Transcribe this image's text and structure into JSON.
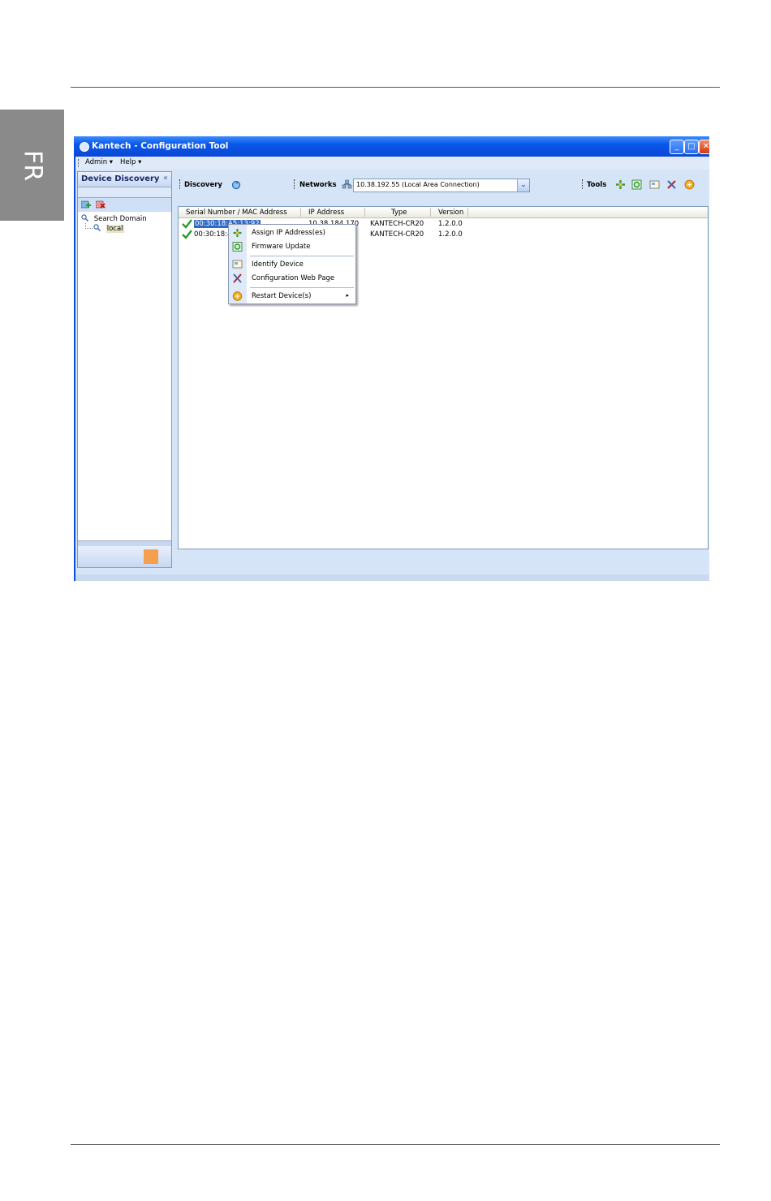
{
  "page": {
    "side_tab": "FR"
  },
  "window": {
    "title": "Kantech - Configuration Tool",
    "controls": {
      "minimize": "_",
      "maximize": "□",
      "close": "✕"
    }
  },
  "menubar": {
    "items": [
      {
        "label": "Admin ▾"
      },
      {
        "label": "Help ▾"
      }
    ]
  },
  "left_panel": {
    "title": "Device Discovery",
    "collapse": "«",
    "tree": {
      "root": "Search Domain",
      "child": "local"
    }
  },
  "toolbar": {
    "discovery_label": "Discovery",
    "networks_label": "Networks",
    "network_value": "10.38.192.55 (Local Area Connection)",
    "tools_label": "Tools"
  },
  "device_list": {
    "columns": [
      "Serial Number / MAC Address",
      "IP Address",
      "Type",
      "Version"
    ],
    "rows": [
      {
        "serial": "00:30:18:A5:13:92",
        "ip": "10.38.184.170",
        "type": "KANTECH-CR20",
        "version": "1.2.0.0"
      },
      {
        "serial": "00:30:18:4",
        "ip": "",
        "type": "KANTECH-CR20",
        "version": "1.2.0.0"
      }
    ]
  },
  "context_menu": {
    "items": [
      {
        "label": "Assign IP Address(es)",
        "icon": "assign-ip-icon"
      },
      {
        "label": "Firmware Update",
        "icon": "firmware-icon"
      },
      {
        "label": "Identify Device",
        "icon": "identify-icon"
      },
      {
        "label": "Configuration Web Page",
        "icon": "web-config-icon"
      },
      {
        "label": "Restart Device(s)",
        "icon": "restart-icon",
        "submenu_arrow": "▸"
      }
    ]
  },
  "colors": {
    "titlebar": "#0a57e8",
    "selection": "#316ac5",
    "panel": "#d6e4f7"
  }
}
